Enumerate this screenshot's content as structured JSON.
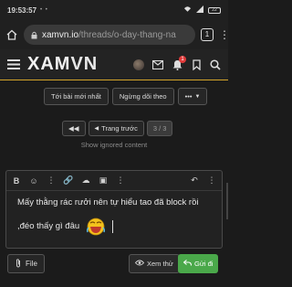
{
  "status": {
    "time": "19:53:57",
    "dots": "• •",
    "battery": "22"
  },
  "browser": {
    "url_host": "xamvn.io",
    "url_path": "/threads/o-day-thang-na",
    "tab_count": "1"
  },
  "header": {
    "logo_a": "XAM",
    "logo_b": "VN",
    "alert_count": "1",
    "colors": {
      "accent": "#d4a32a",
      "badge": "#e03a3a"
    }
  },
  "thread_actions": {
    "latest": "Tới bài mới nhất",
    "unwatch": "Ngừng dõi theo",
    "more": "•••"
  },
  "pager": {
    "prev": "Trang trước",
    "current": "3 / 3"
  },
  "ignored": "Show ignored content",
  "editor": {
    "line1": "Mấy thằng rác rưởi nên tự hiểu tao đã block rồi",
    "line2": ",đéo thấy gì đâu"
  },
  "buttons": {
    "file": "File",
    "preview": "Xem thử",
    "send": "Gửi đi",
    "send_color": "#4aa84a"
  }
}
